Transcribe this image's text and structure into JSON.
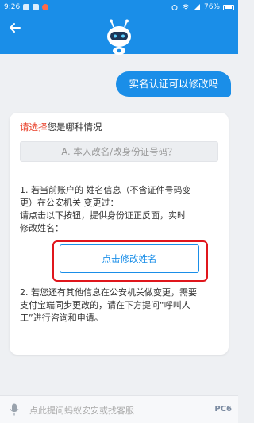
{
  "status": {
    "time": "9:26",
    "battery": "76%"
  },
  "user_message": "实名认证可以修改吗",
  "card": {
    "prompt_highlight": "请选择",
    "prompt_rest": "您是哪种情况",
    "option_label": "A. 本人改名/改身份证号码？",
    "para1_lines": [
      "1. 若当前账户的 姓名信息（不含证件号码变",
      "更）在公安机关 变更过：",
      " 请点击以下按钮，提供身份证正反面，实时",
      "修改姓名："
    ],
    "action_button": "点击修改姓名",
    "para2_lines": [
      "2. 若您还有其他信息在公安机关做变更，需要",
      "支付宝端同步更改的，请在下方提问“呼叫人",
      "工”进行咨询和申请。"
    ]
  },
  "input": {
    "placeholder": "点此提问蚂蚁安安或找客服"
  },
  "watermark": "PC6"
}
